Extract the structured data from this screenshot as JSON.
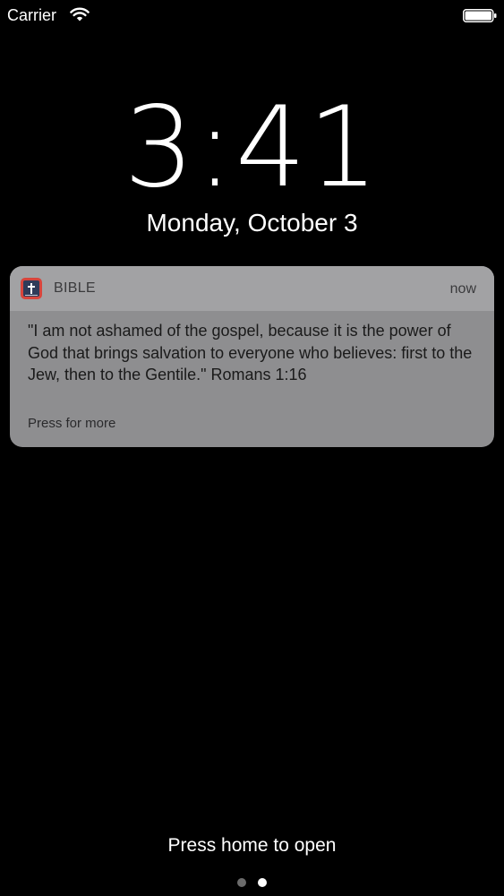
{
  "status_bar": {
    "carrier": "Carrier",
    "wifi_icon": "wifi-icon",
    "battery_icon": "battery-icon"
  },
  "lock_screen": {
    "time": "3:41",
    "date": "Monday, October 3"
  },
  "notification": {
    "app_icon": "bible-app-icon",
    "app_name": "BIBLE",
    "time": "now",
    "message": "\"I am not ashamed of the gospel, because it is the power of God that brings salvation to everyone who believes: first to the Jew, then to the Gentile.\" Romans 1:16",
    "more_label": "Press for more"
  },
  "footer": {
    "unlock_hint": "Press home to open",
    "pages": {
      "count": 2,
      "current": 2
    }
  },
  "colors": {
    "background": "#000000",
    "notification_body": "#8e8e90",
    "notification_header": "#a2a2a4",
    "app_icon_red": "#d8453c",
    "app_icon_navy": "#2f3b59"
  }
}
